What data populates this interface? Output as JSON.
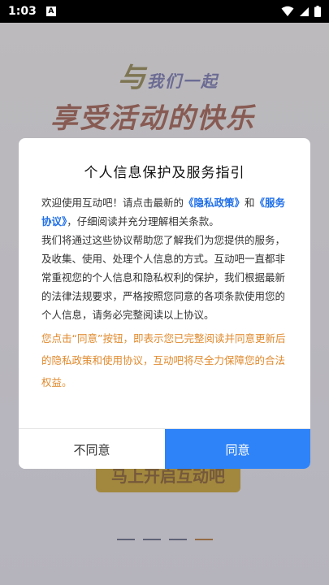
{
  "status_bar": {
    "time": "1:03",
    "notification_icon": "A"
  },
  "splash": {
    "slogan_big": "与",
    "slogan_small": "我们一起",
    "slogan_line2": "享受活动的快乐",
    "start_button": "马上开启互动吧"
  },
  "dialog": {
    "title": "个人信息保护及服务指引",
    "welcome_prefix": "欢迎使用互动吧！请点击最新的",
    "privacy_link": "《隐私政策》",
    "and": "和",
    "service_link": "《服务协议》",
    "welcome_suffix": "，仔细阅读并充分理解相关条款。",
    "body": "我们将通过这些协议帮助您了解我们为您提供的服务，及收集、使用、处理个人信息的方式。互动吧一直都非常重视您的个人信息和隐私权利的保护，我们根据最新的法律法规要求，严格按照您同意的各项条款使用您的个人信息，请务必完整阅读以上协议。",
    "notice": "您点击“同意”按钮，即表示您已完整阅读并同意更新后的隐私政策和使用协议，互动吧将尽全力保障您的合法权益。",
    "disagree_label": "不同意",
    "agree_label": "同意"
  },
  "colors": {
    "accent_blue": "#2f83f8",
    "notice_orange": "#e0892c",
    "link_blue": "#1e6ee8"
  }
}
